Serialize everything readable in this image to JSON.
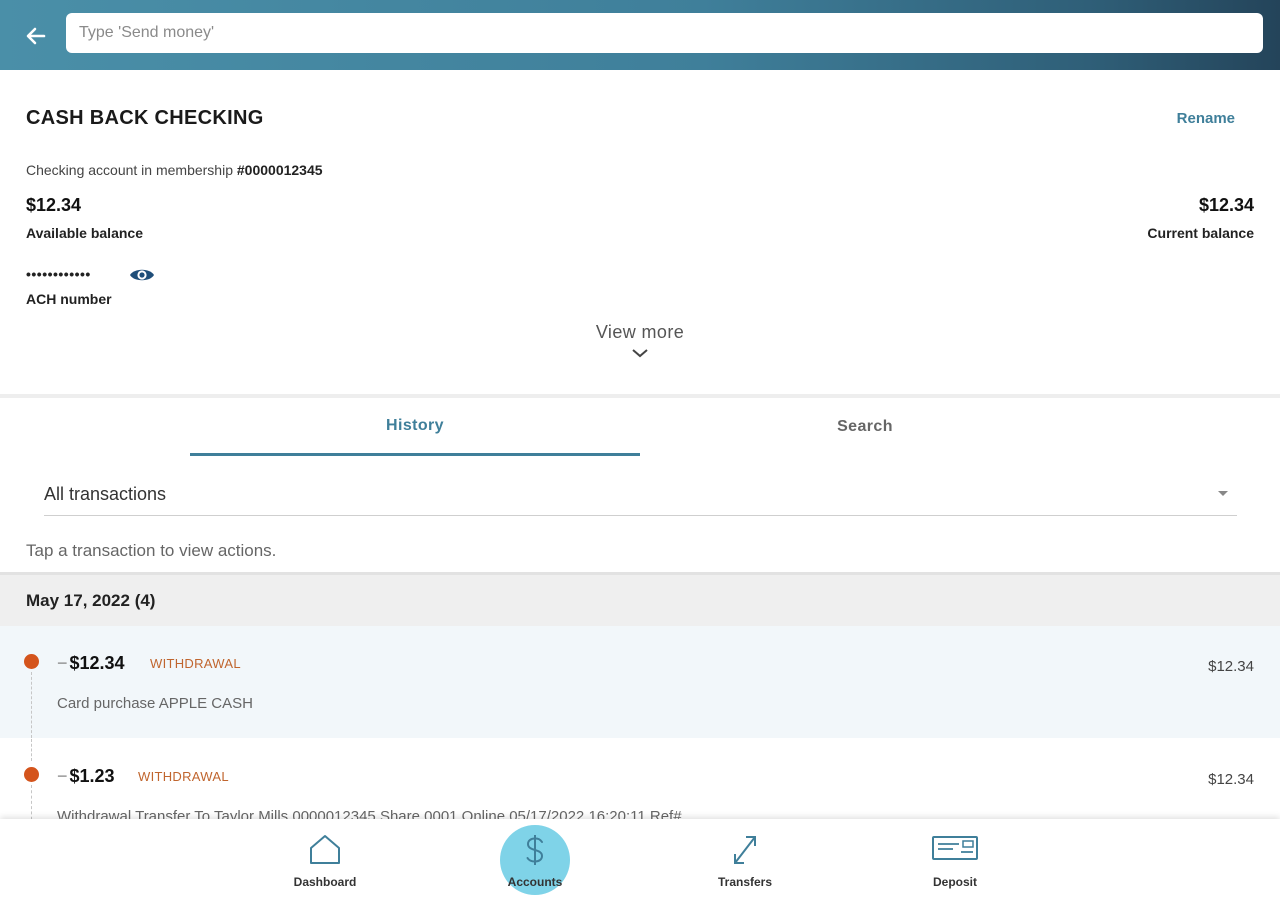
{
  "header": {
    "back_icon": "arrow-left-icon",
    "search_placeholder": "Type 'Send money'",
    "gradient_colors": [
      "#4a8fa8",
      "#24445a"
    ]
  },
  "account": {
    "title": "CASH BACK CHECKING",
    "rename_label": "Rename",
    "membership_prefix": "Checking account in membership ",
    "membership_number": "#0000012345",
    "available_amount": "$12.34",
    "available_label": "Available balance",
    "current_amount": "$12.34",
    "current_label": "Current balance",
    "ach_masked": "••••••••••••",
    "ach_label": "ACH number",
    "ach_toggle_icon": "eye-icon",
    "view_more_label": "View more",
    "view_more_icon": "chevron-down-icon"
  },
  "tabs": [
    {
      "label": "History",
      "active": true
    },
    {
      "label": "Search",
      "active": false
    }
  ],
  "filter": {
    "selected": "All transactions",
    "caret_icon": "caret-down-icon"
  },
  "hint": "Tap a transaction to view actions.",
  "groups": [
    {
      "date_label": "May 17, 2022 (4)",
      "transactions": [
        {
          "sign": "−",
          "amount": "$12.34",
          "type": "WITHDRAWAL",
          "balance": "$12.34",
          "description": "Card purchase APPLE CASH"
        },
        {
          "sign": "−",
          "amount": "$1.23",
          "type": "WITHDRAWAL",
          "balance": "$12.34",
          "description": "Withdrawal Transfer To Taylor Mills 0000012345 Share 0001 Online 05/17/2022 16:20:11 Ref#"
        }
      ]
    }
  ],
  "bottom_nav": [
    {
      "label": "Dashboard",
      "icon": "home-icon",
      "active": false
    },
    {
      "label": "Accounts",
      "icon": "dollar-icon",
      "active": true
    },
    {
      "label": "Transfers",
      "icon": "arrows-diagonal-icon",
      "active": false
    },
    {
      "label": "Deposit",
      "icon": "check-deposit-icon",
      "active": false
    }
  ],
  "colors": {
    "accent": "#3f7f9a",
    "withdrawal": "#c0652e",
    "dot": "#d4541c",
    "nav_active": "#7fd3e8"
  }
}
